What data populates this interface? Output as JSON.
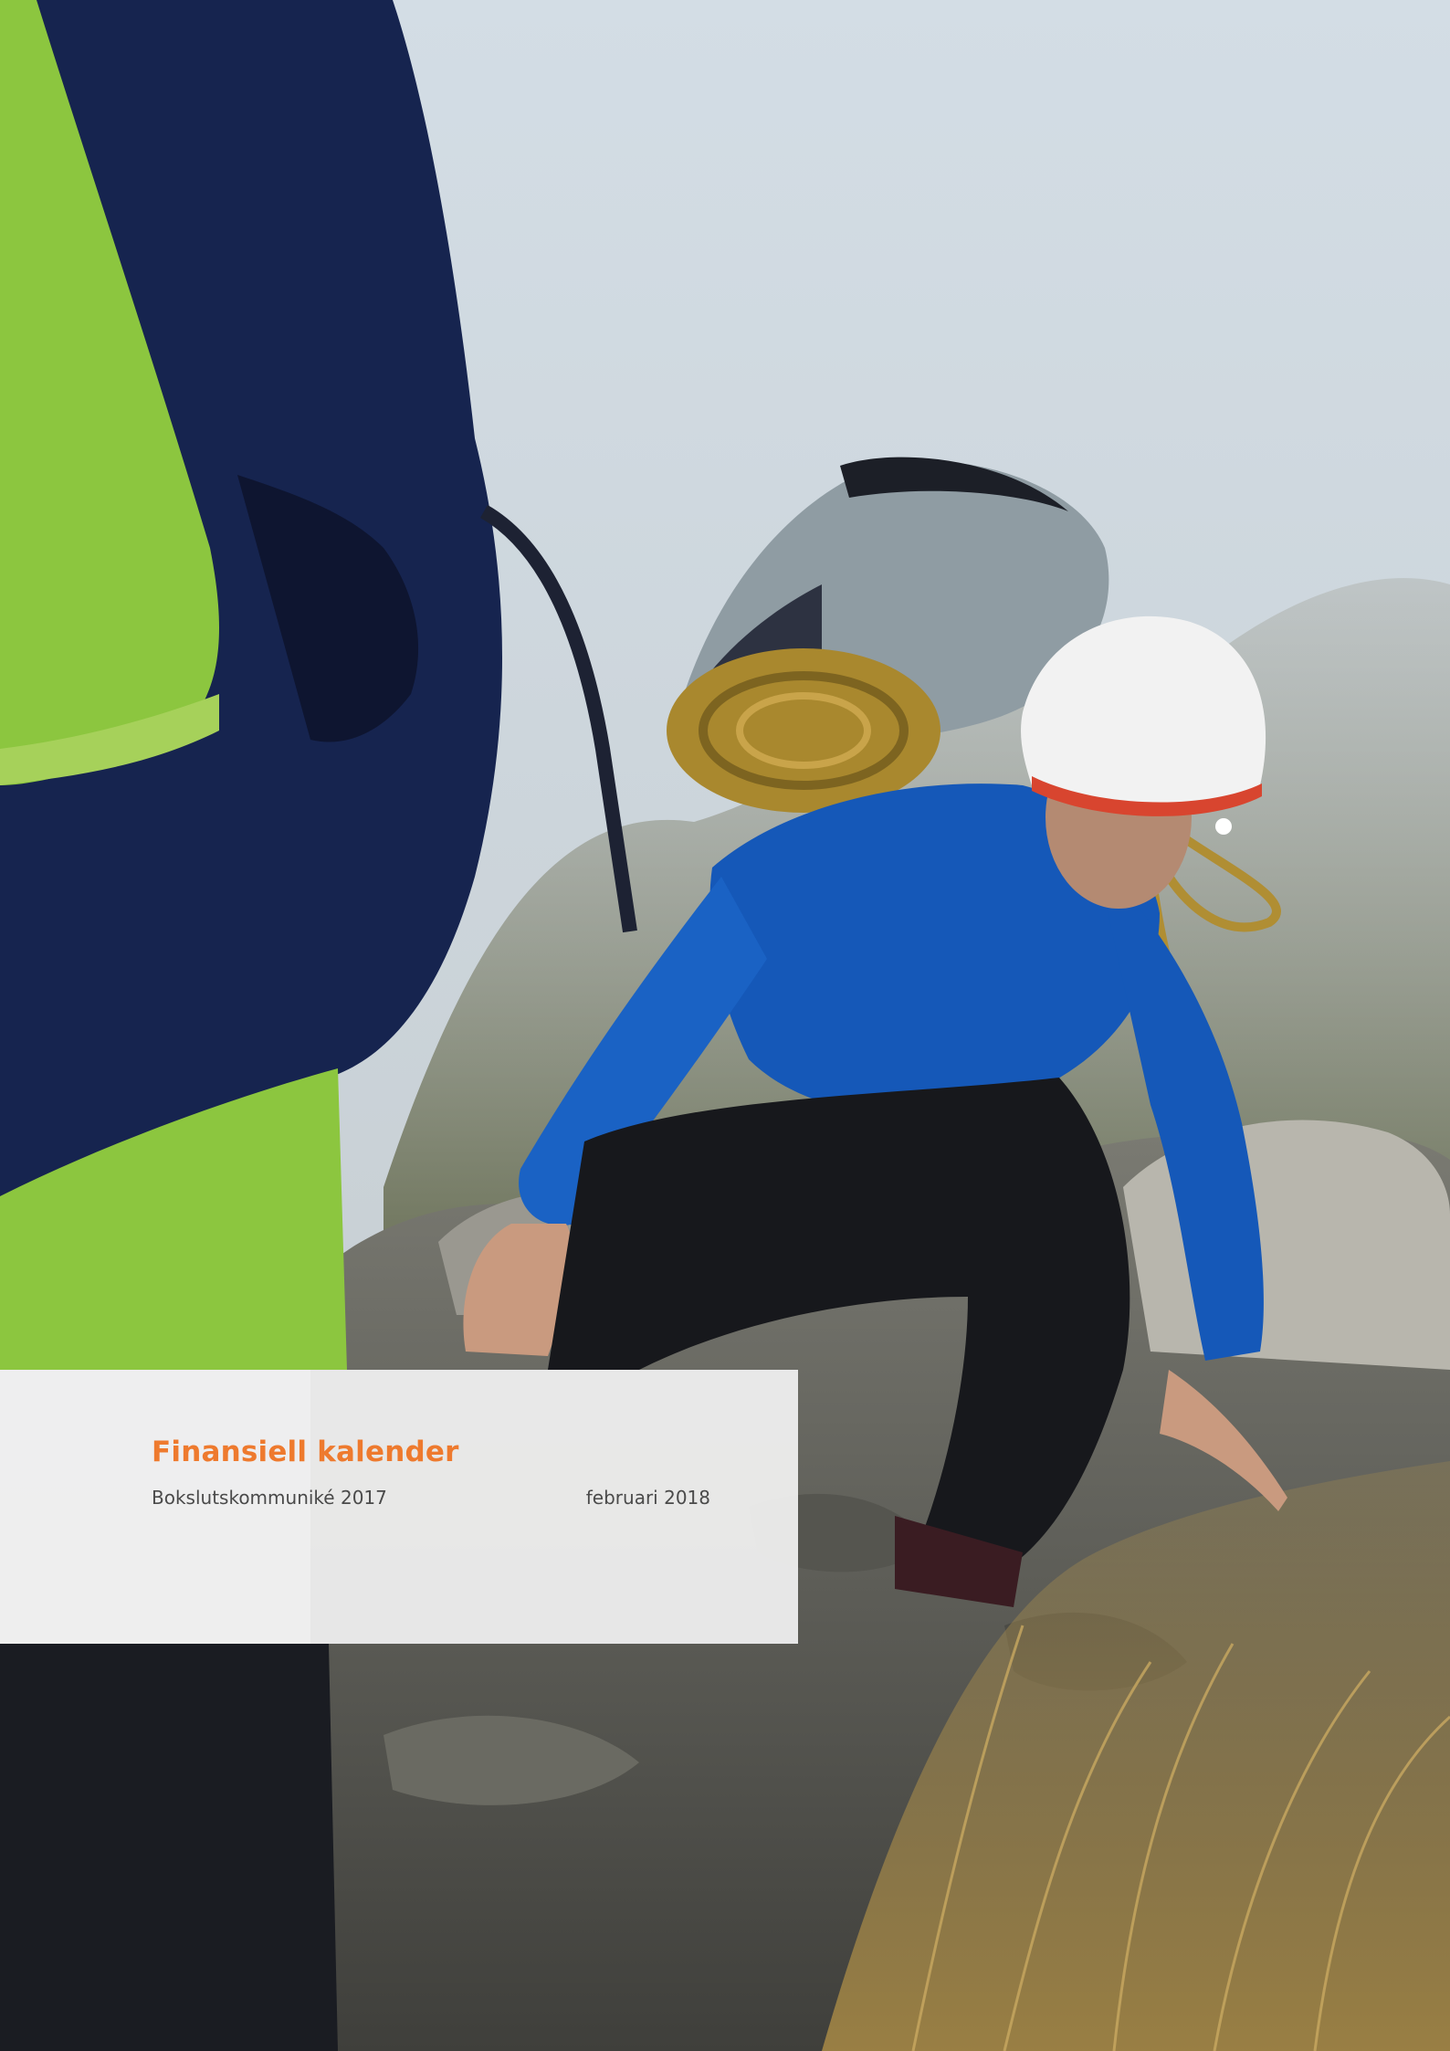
{
  "calendar": {
    "title": "Finansiell kalender",
    "events": [
      {
        "name": "Bokslutskommuniké 2017",
        "date": "februari 2018"
      }
    ]
  },
  "colors": {
    "accent": "#ee7a2e",
    "body_text": "#4a4a4a",
    "panel": "#f0f0f0"
  }
}
